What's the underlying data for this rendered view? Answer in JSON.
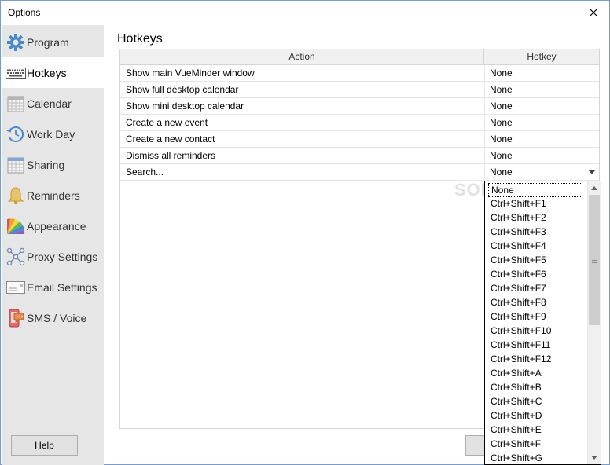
{
  "window": {
    "title": "Options"
  },
  "sidebar": {
    "items": [
      {
        "label": "Program",
        "icon": "gear-icon"
      },
      {
        "label": "Hotkeys",
        "icon": "keyboard-icon",
        "active": true
      },
      {
        "label": "Calendar",
        "icon": "calendar-icon"
      },
      {
        "label": "Work Day",
        "icon": "clock-icon"
      },
      {
        "label": "Sharing",
        "icon": "shared-calendar-icon"
      },
      {
        "label": "Reminders",
        "icon": "bell-icon"
      },
      {
        "label": "Appearance",
        "icon": "palette-icon"
      },
      {
        "label": "Proxy Settings",
        "icon": "network-icon"
      },
      {
        "label": "Email Settings",
        "icon": "envelope-icon"
      },
      {
        "label": "SMS / Voice",
        "icon": "phone-message-icon"
      }
    ],
    "help_label": "Help"
  },
  "main": {
    "title": "Hotkeys",
    "columns": [
      "Action",
      "Hotkey"
    ],
    "rows": [
      {
        "action": "Show main VueMinder window",
        "hotkey": "None"
      },
      {
        "action": "Show full desktop calendar",
        "hotkey": "None"
      },
      {
        "action": "Show mini desktop calendar",
        "hotkey": "None"
      },
      {
        "action": "Create a new event",
        "hotkey": "None"
      },
      {
        "action": "Create a new contact",
        "hotkey": "None"
      },
      {
        "action": "Dismiss all reminders",
        "hotkey": "None"
      },
      {
        "action": "Search...",
        "hotkey": "None"
      }
    ]
  },
  "dropdown": {
    "selected": "None",
    "options": [
      "None",
      "Ctrl+Shift+F1",
      "Ctrl+Shift+F2",
      "Ctrl+Shift+F3",
      "Ctrl+Shift+F4",
      "Ctrl+Shift+F5",
      "Ctrl+Shift+F6",
      "Ctrl+Shift+F7",
      "Ctrl+Shift+F8",
      "Ctrl+Shift+F9",
      "Ctrl+Shift+F10",
      "Ctrl+Shift+F11",
      "Ctrl+Shift+F12",
      "Ctrl+Shift+A",
      "Ctrl+Shift+B",
      "Ctrl+Shift+C",
      "Ctrl+Shift+D",
      "Ctrl+Shift+E",
      "Ctrl+Shift+F",
      "Ctrl+Shift+G"
    ]
  },
  "watermark": "SOFTPEDIA",
  "colors": {
    "sidebar_bg": "#e6e6e6",
    "accent": "#3b8ed8"
  }
}
